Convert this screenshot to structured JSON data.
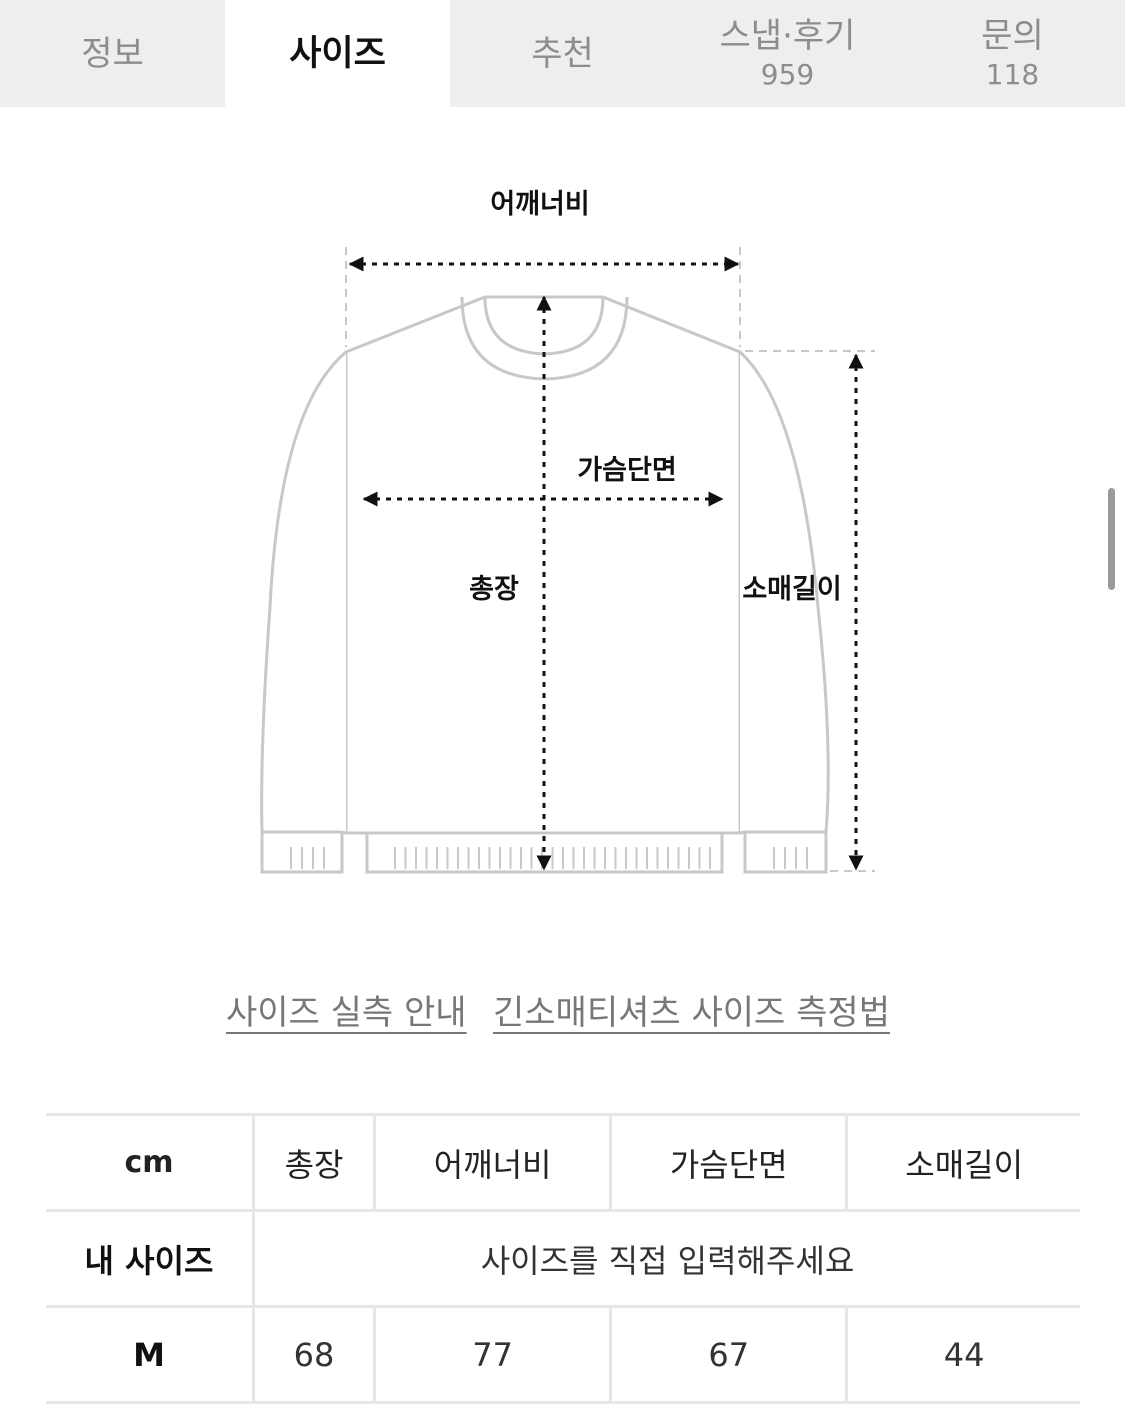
{
  "tabs": [
    {
      "label": "정보",
      "count": ""
    },
    {
      "label": "사이즈",
      "count": ""
    },
    {
      "label": "추천",
      "count": ""
    },
    {
      "label": "스냅·후기",
      "count": "959"
    },
    {
      "label": "문의",
      "count": "118"
    }
  ],
  "active_tab": "사이즈",
  "diagram": {
    "labels": {
      "shoulder": "어깨너비",
      "chest": "가슴단면",
      "length": "총장",
      "sleeve": "소매길이"
    }
  },
  "links": {
    "size_guide": "사이즈 실측 안내",
    "measure_method": "긴소매티셔츠 사이즈 측정법"
  },
  "table": {
    "unit": "cm",
    "columns": [
      "총장",
      "어깨너비",
      "가슴단면",
      "소매길이"
    ],
    "my_size_label": "내 사이즈",
    "my_size_placeholder": "사이즈를 직접 입력해주세요",
    "rows": [
      {
        "size": "M",
        "values": [
          "68",
          "77",
          "67",
          "44"
        ]
      }
    ]
  }
}
